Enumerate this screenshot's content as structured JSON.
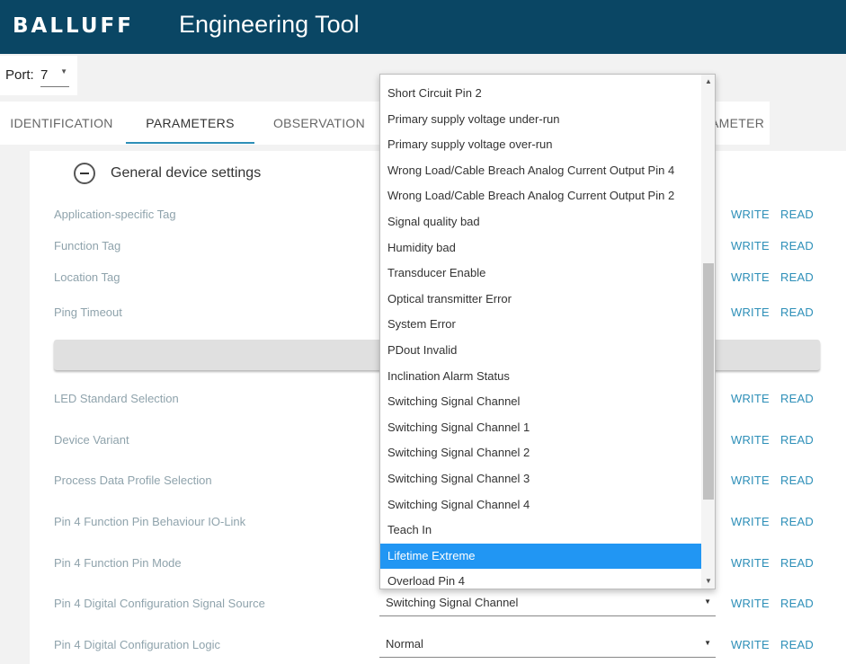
{
  "header": {
    "logo": "BALLUFF",
    "title": "Engineering Tool"
  },
  "port": {
    "label": "Port:",
    "value": "7"
  },
  "tabs": [
    {
      "label": "IDENTIFICATION"
    },
    {
      "label": "PARAMETERS"
    },
    {
      "label": "OBSERVATION"
    },
    {
      "label": "AMETER"
    }
  ],
  "section": {
    "title": "General device settings"
  },
  "actions": {
    "write": "WRITE",
    "read": "READ"
  },
  "params": [
    {
      "label": "Application-specific Tag"
    },
    {
      "label": "Function Tag"
    },
    {
      "label": "Location Tag"
    },
    {
      "label": "Ping Timeout"
    },
    {
      "label": "LED Standard Selection"
    },
    {
      "label": "Device Variant"
    },
    {
      "label": "Process Data Profile Selection"
    },
    {
      "label": "Pin 4 Function Pin Behaviour IO-Link"
    },
    {
      "label": "Pin 4 Function Pin Mode"
    },
    {
      "label": "Pin 4 Digital Configuration Signal Source",
      "value": "Switching Signal Channel"
    },
    {
      "label": "Pin 4 Digital Configuration Logic",
      "value": "Normal"
    }
  ],
  "dropdown": {
    "selected": "Lifetime Extreme",
    "options": [
      "Short Circuit Pin 2",
      "Primary supply voltage under-run",
      "Primary supply voltage over-run",
      "Wrong Load/Cable Breach Analog Current Output Pin 4",
      "Wrong Load/Cable Breach Analog Current Output Pin 2",
      "Signal quality bad",
      "Humidity bad",
      "Transducer Enable",
      "Optical transmitter Error",
      "System Error",
      "PDout Invalid",
      "Inclination Alarm Status",
      "Switching Signal Channel",
      "Switching Signal Channel 1",
      "Switching Signal Channel 2",
      "Switching Signal Channel 3",
      "Switching Signal Channel 4",
      "Teach In",
      "Lifetime Extreme",
      "Overload Pin 4"
    ]
  },
  "colors": {
    "header_bg": "#0a4664",
    "accent": "#2d8fb8",
    "selected_option": "#2196f3"
  }
}
